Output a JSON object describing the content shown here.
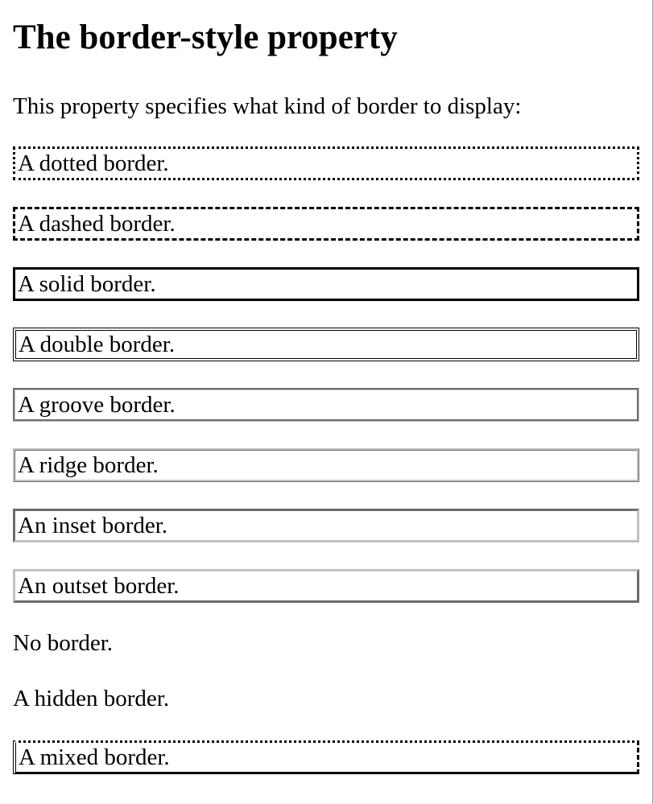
{
  "heading": "The border-style property",
  "intro": "This property specifies what kind of border to display:",
  "examples": [
    {
      "style": "dotted",
      "text": "A dotted border."
    },
    {
      "style": "dashed",
      "text": "A dashed border."
    },
    {
      "style": "solid",
      "text": "A solid border."
    },
    {
      "style": "double",
      "text": "A double border."
    },
    {
      "style": "groove",
      "text": "A groove border."
    },
    {
      "style": "ridge",
      "text": "A ridge border."
    },
    {
      "style": "inset",
      "text": "An inset border."
    },
    {
      "style": "outset",
      "text": "An outset border."
    },
    {
      "style": "none",
      "text": "No border."
    },
    {
      "style": "hidden",
      "text": "A hidden border."
    },
    {
      "style": "mixed",
      "text": "A mixed border."
    }
  ],
  "colors": {
    "text": "#000000",
    "background": "#ffffff",
    "border_dark": "#000000",
    "border_3d": "#c0c0c0"
  }
}
